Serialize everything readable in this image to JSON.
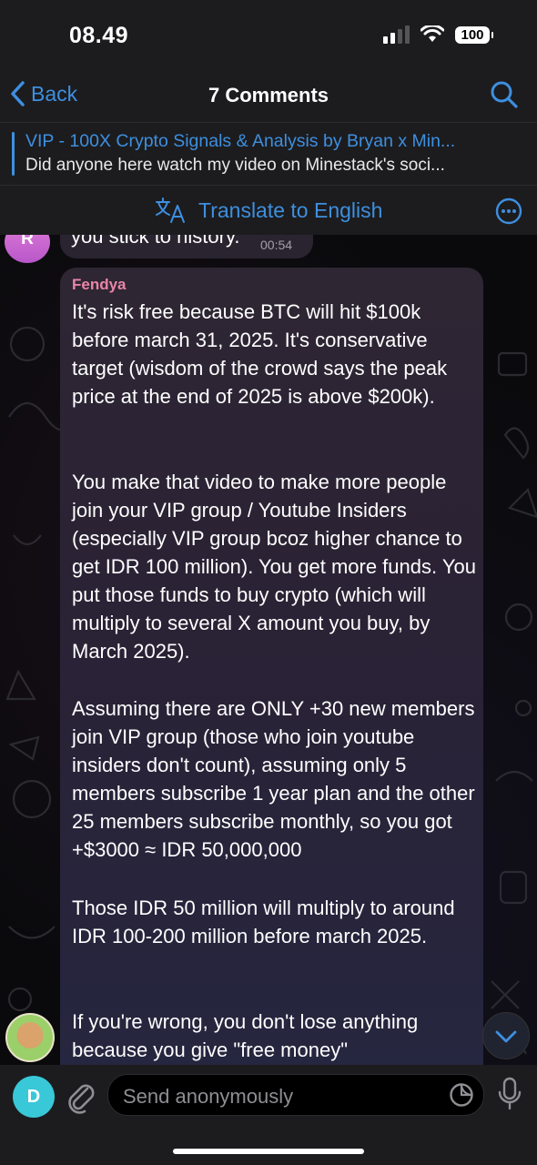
{
  "status_bar": {
    "time": "08.49",
    "battery": "100"
  },
  "nav": {
    "back_label": "Back",
    "title": "7 Comments"
  },
  "pinned": {
    "title": "VIP - 100X Crypto Signals & Analysis by Bryan x Min...",
    "subtitle": "Did anyone here watch my video on Minestack's soci..."
  },
  "translate": {
    "label": "Translate to English"
  },
  "previous_message": {
    "avatar_letter": "R",
    "text": "you stick to history.",
    "time": "00:54"
  },
  "message": {
    "sender": "Fendya",
    "paragraphs": [
      "It's risk free because BTC will hit $100k before march 31, 2025. It's conservative target (wisdom of the crowd says the peak price at the end of 2025 is above $200k).",
      "You make that video to make more people join your VIP group / Youtube Insiders (especially VIP group bcoz higher chance to get IDR 100 million). You get more funds. You put those funds to buy crypto (which will multiply to several X amount you buy, by March 2025).",
      "Assuming there are ONLY +30 new members join VIP group (those who join youtube insiders don't count), assuming only 5 members subscribe 1 year plan and the other 25 members subscribe monthly, so you got +$3000 ≈ IDR 50,000,000",
      "Those IDR 50 million will multiply to around IDR 100-200 million before march 2025.",
      "If you're wrong, you don't lose anything because you give \"free money\""
    ]
  },
  "input": {
    "avatar_letter": "D",
    "placeholder": "Send anonymously"
  },
  "colors": {
    "accent": "#3e8fe0",
    "sender_name": "#e985a8"
  }
}
